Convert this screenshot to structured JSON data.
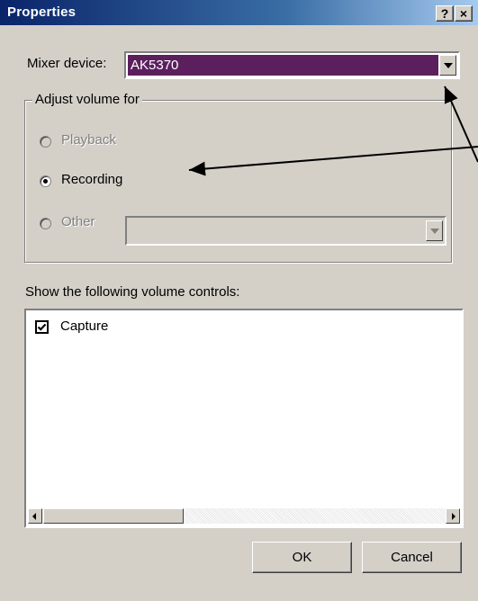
{
  "window": {
    "title": "Properties",
    "help_label": "?",
    "close_label": "×"
  },
  "mixer": {
    "label": "Mixer device:",
    "value": "AK5370"
  },
  "adjust": {
    "legend": "Adjust volume for",
    "playback_label": "Playback",
    "recording_label": "Recording",
    "other_label": "Other",
    "selected": "Recording"
  },
  "controls": {
    "label": "Show the following volume controls:",
    "items": [
      {
        "label": "Capture",
        "checked": true
      }
    ]
  },
  "buttons": {
    "ok": "OK",
    "cancel": "Cancel"
  },
  "colors": {
    "titlebar_start": "#0a246a",
    "titlebar_end": "#a6caf0",
    "selection": "#5c1f5e",
    "face": "#d4d0c8"
  }
}
